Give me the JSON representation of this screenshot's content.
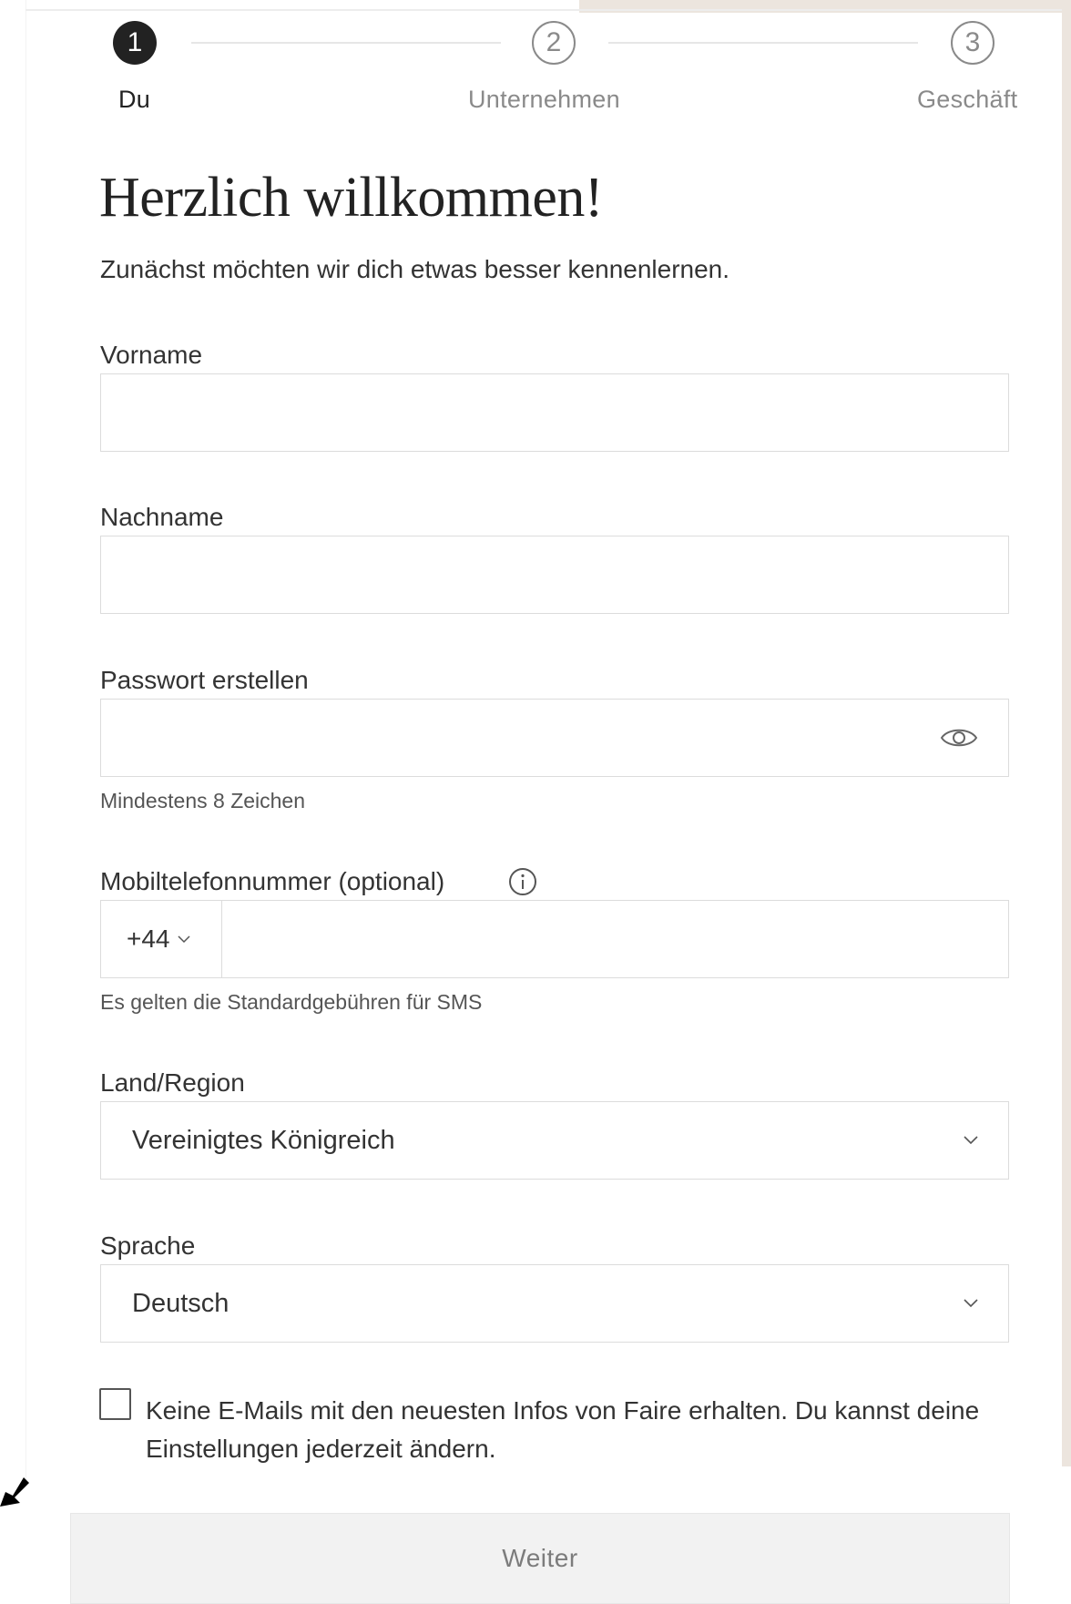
{
  "stepper": {
    "steps": [
      {
        "number": "1",
        "label": "Du",
        "state": "active"
      },
      {
        "number": "2",
        "label": "Unternehmen",
        "state": "inactive"
      },
      {
        "number": "3",
        "label": "Geschäft",
        "state": "inactive"
      }
    ]
  },
  "header": {
    "title": "Herzlich willkommen!",
    "subtitle": "Zunächst möchten wir dich etwas besser kennenlernen."
  },
  "form": {
    "first_name": {
      "label": "Vorname",
      "value": ""
    },
    "last_name": {
      "label": "Nachname",
      "value": ""
    },
    "password": {
      "label": "Passwort erstellen",
      "value": "",
      "helper": "Mindestens 8 Zeichen",
      "icon": "eye-icon"
    },
    "phone": {
      "label": "Mobiltelefonnummer (optional)",
      "prefix": "+44",
      "value": "",
      "helper": "Es gelten die Standardgebühren für SMS",
      "icon": "info-icon"
    },
    "country": {
      "label": "Land/Region",
      "value": "Vereinigtes Königreich"
    },
    "language": {
      "label": "Sprache",
      "value": "Deutsch"
    },
    "newsletter_optout": {
      "checked": false,
      "text": "Keine E-Mails mit den neuesten Infos von Faire erhalten. Du kannst deine Einstellungen jederzeit ändern."
    }
  },
  "actions": {
    "continue_label": "Weiter"
  },
  "colors": {
    "text": "#222222",
    "muted": "#8a8a8a",
    "border": "#dcdcdc",
    "button_bg": "#f2f2f2",
    "beige": "#ece5de"
  }
}
